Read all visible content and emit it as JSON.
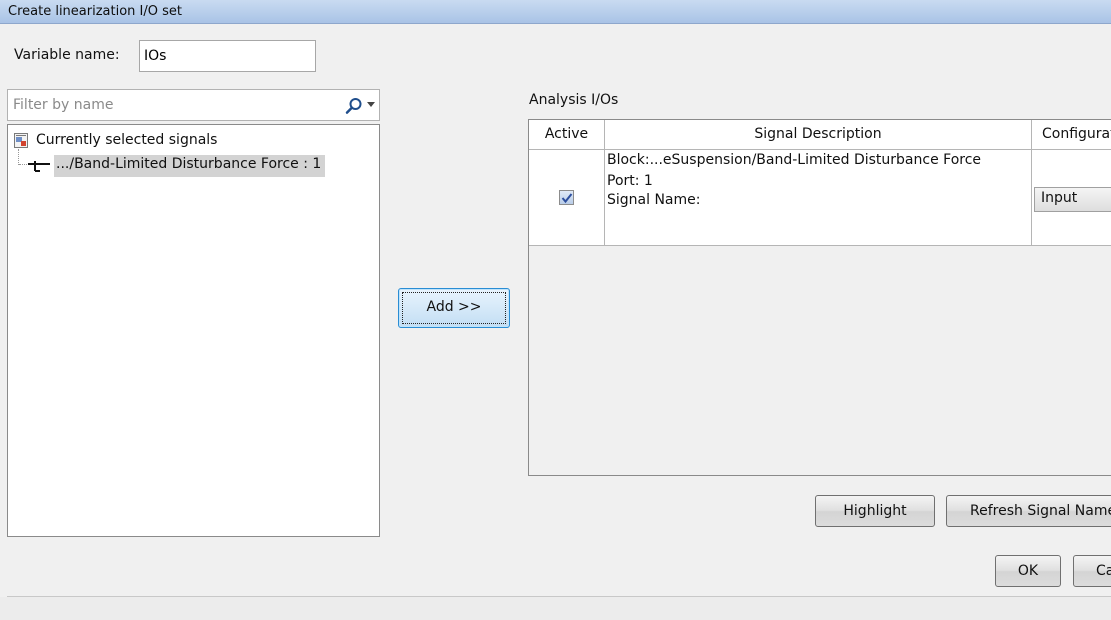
{
  "window": {
    "title": "Create linearization I/O set"
  },
  "variable": {
    "label": "Variable name:",
    "value": "IOs"
  },
  "filter": {
    "placeholder": "Filter by name"
  },
  "tree": {
    "root_label": "Currently selected signals",
    "child_label": ".../Band-Limited  Disturbance Force : 1"
  },
  "add_button": {
    "label": "Add >>"
  },
  "analysis": {
    "label": "Analysis I/Os",
    "columns": [
      "Active",
      "Signal Description",
      "Configuration"
    ],
    "rows": [
      {
        "active": true,
        "block": "Block:...eSuspension/Band-Limited Disturbance Force",
        "port": "Port: 1",
        "signal_name": "Signal Name:",
        "configuration": "Input"
      }
    ]
  },
  "buttons": {
    "highlight": "Highlight",
    "refresh": "Refresh Signal Names",
    "ok": "OK",
    "cancel": "Cancel"
  }
}
